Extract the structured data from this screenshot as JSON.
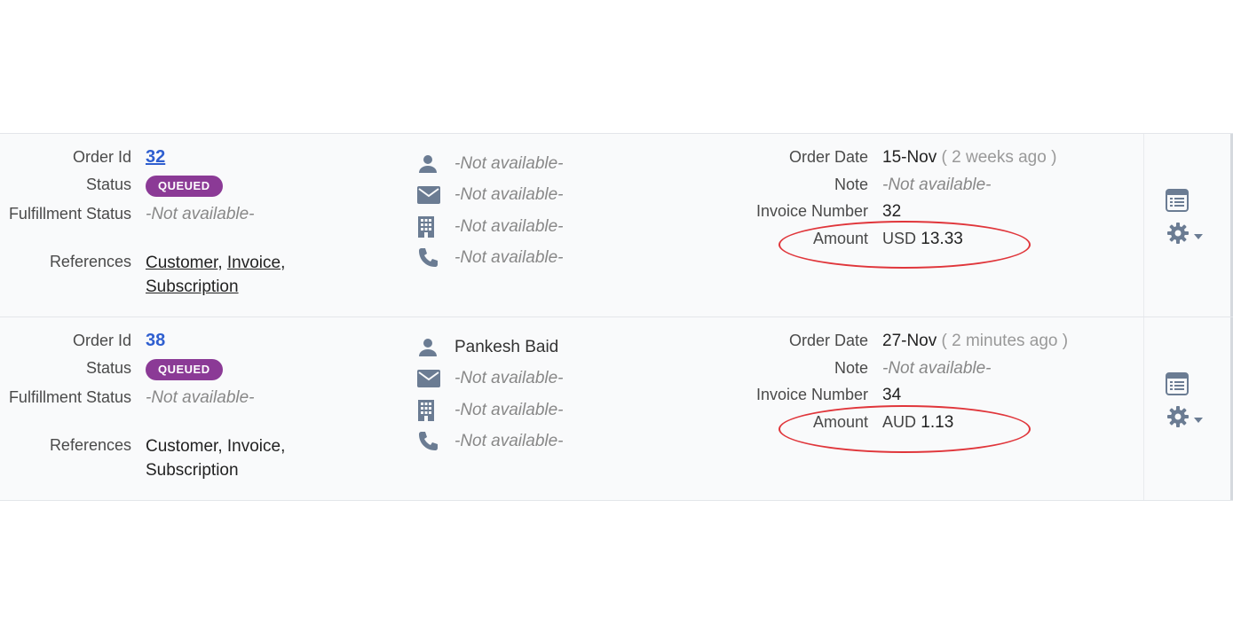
{
  "labels": {
    "order_id": "Order Id",
    "status": "Status",
    "fulfillment_status": "Fulfillment Status",
    "references": "References",
    "order_date": "Order Date",
    "note": "Note",
    "invoice_number": "Invoice Number",
    "amount": "Amount"
  },
  "orders": [
    {
      "id": "32",
      "status": "QUEUED",
      "fulfillment": "-Not available-",
      "refs": {
        "r1": "Customer",
        "r2": "Invoice",
        "r3": "Subscription"
      },
      "contact": {
        "name": "-Not available-",
        "email": "-Not available-",
        "company": "-Not available-",
        "phone": "-Not available-"
      },
      "order_date": "15-Nov",
      "relative_date": "( 2 weeks ago )",
      "note": "-Not available-",
      "invoice_number": "32",
      "currency": "USD",
      "amount": "13.33"
    },
    {
      "id": "38",
      "status": "QUEUED",
      "fulfillment": "-Not available-",
      "refs": {
        "r1": "Customer",
        "r2": "Invoice",
        "r3": "Subscription"
      },
      "contact": {
        "name": "Pankesh Baid",
        "email": "-Not available-",
        "company": "-Not available-",
        "phone": "-Not available-"
      },
      "order_date": "27-Nov",
      "relative_date": "( 2 minutes ago )",
      "note": "-Not available-",
      "invoice_number": "34",
      "currency": "AUD",
      "amount": "1.13"
    }
  ],
  "colors": {
    "badge": "#8b3a96",
    "link": "#2f5fd0",
    "annotation": "#e0363b",
    "icon": "#6b7c93"
  },
  "icons": [
    "person-icon",
    "email-icon",
    "building-icon",
    "phone-icon",
    "list-view-icon",
    "gear-icon",
    "caret-down-icon"
  ]
}
